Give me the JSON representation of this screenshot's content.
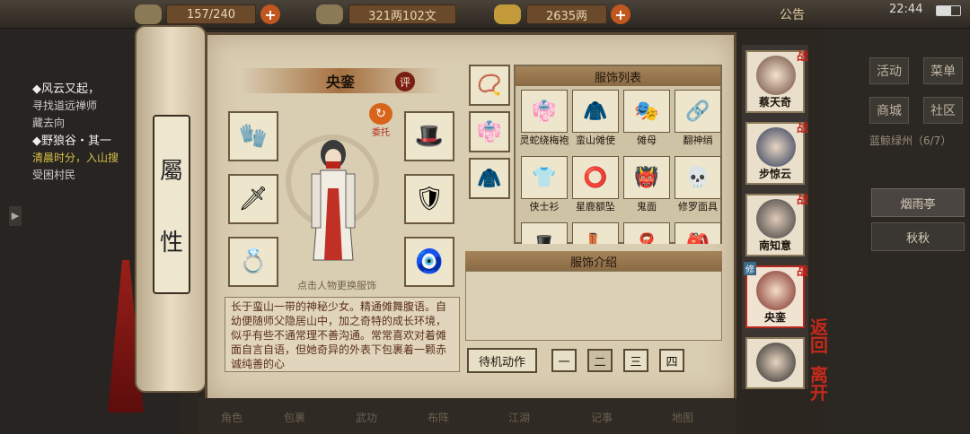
{
  "topbar": {
    "storage": "157/240",
    "money_copper": "321两102文",
    "money_silver": "2635两",
    "announce": "公告",
    "time": "22:44"
  },
  "quests": [
    {
      "title": "◆风云又起，",
      "desc": [
        "寻找道远禅师",
        "藏去向"
      ]
    },
    {
      "title": "◆野狼谷・其一",
      "desc": [
        "清晨时分，入山搜",
        "受困村民"
      ]
    }
  ],
  "right_menu": {
    "buttons": [
      "活动",
      "菜单",
      "商城",
      "社区"
    ],
    "location": "蓝鲸绿州（6/7）",
    "tabs": [
      "烟雨亭",
      "秋秋"
    ]
  },
  "scroll": {
    "title_chars": [
      "屬",
      "性"
    ]
  },
  "character": {
    "name": "央銮",
    "ping_label": "评",
    "weituo_label": "委托",
    "change_hint": "点击人物更换服饰",
    "description": "长于蛮山一带的神秘少女。精通傩舞腹语。自幼便随师父隐居山中，加之奇特的成长环境，似乎有些不通常理不善沟通。常常喜欢对着傩面自言自语，但她奇异的外表下包裹着一颗赤诚纯善的心"
  },
  "slots_left": [
    "glove-icon",
    "sword-icon",
    "ring-icon"
  ],
  "slots_right": [
    "hat-icon",
    "armor-icon",
    "amulet-icon"
  ],
  "outfit_list": {
    "header": "服饰列表",
    "items": [
      {
        "label": "灵蛇绕梅袍",
        "icon": "👘"
      },
      {
        "label": "蛮山傩使",
        "icon": "🧥"
      },
      {
        "label": "傩母",
        "icon": "🎭"
      },
      {
        "label": "翻神绡",
        "icon": "🔗"
      },
      {
        "label": "侠士衫",
        "icon": "👕"
      },
      {
        "label": "星鹿额坠",
        "icon": "⭕"
      },
      {
        "label": "鬼面",
        "icon": "👹"
      },
      {
        "label": "修罗面具",
        "icon": "💀"
      },
      {
        "label": "",
        "icon": "🎩"
      },
      {
        "label": "",
        "icon": "👢"
      },
      {
        "label": "",
        "icon": "🧣"
      },
      {
        "label": "",
        "icon": "🎒"
      }
    ]
  },
  "categories": [
    "📿",
    "👘",
    "🧥"
  ],
  "intro": {
    "header": "服饰介绍"
  },
  "actions": {
    "label": "待机动作",
    "buttons": [
      "一",
      "二",
      "三",
      "四"
    ]
  },
  "party": [
    {
      "name": "蔡天奇",
      "badge": "战"
    },
    {
      "name": "步惊云",
      "badge": "战"
    },
    {
      "name": "南知意",
      "badge": "战"
    },
    {
      "name": "央銮",
      "badge": "战",
      "tag": "修"
    },
    {
      "name": "",
      "badge": ""
    }
  ],
  "side_actions": {
    "back": "返回",
    "leave": "离开"
  },
  "bottom_menu": [
    "角色",
    "包裹",
    "武功",
    "布阵",
    "江湖",
    "记事",
    "地图"
  ]
}
